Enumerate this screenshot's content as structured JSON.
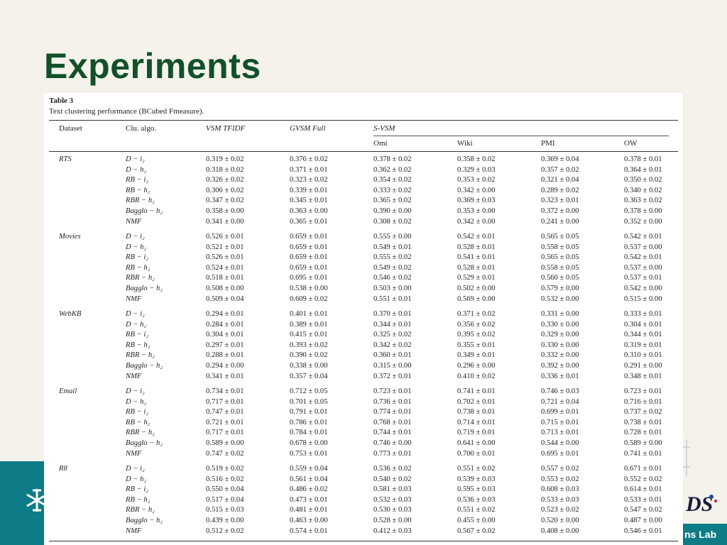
{
  "slide": {
    "title": "Experiments",
    "footer_lab_text": "ns Lab",
    "logo_text": "DS"
  },
  "table": {
    "number": "Table 3",
    "caption": "Text clustering performance (BCubed Fmeasure).",
    "headers": {
      "dataset": "Dataset",
      "algo": "Clu. algo.",
      "vsm": "VSM TFIDF",
      "gvsm": "GVSM Full",
      "svsm": "S-VSM",
      "omi": "Omi",
      "wiki": "Wiki",
      "pmi": "PMI",
      "ow": "OW"
    },
    "groups": [
      {
        "dataset": "RTS",
        "rows": [
          {
            "algo": "D − i₂",
            "vals": [
              "0.319 ± 0.02",
              "0.376 ± 0.02",
              "0.378 ± 0.02",
              "0.358 ± 0.02",
              "0.369 ± 0.04",
              "0.378 ± 0.01"
            ]
          },
          {
            "algo": "D − h₂",
            "vals": [
              "0.318 ± 0.02",
              "0.371 ± 0.01",
              "0.362 ± 0.02",
              "0.329 ± 0.03",
              "0.357 ± 0.02",
              "0.364 ± 0.01"
            ]
          },
          {
            "algo": "RB − i₂",
            "vals": [
              "0.326 ± 0.02",
              "0.323 ± 0.02",
              "0.354 ± 0.02",
              "0.353 ± 0.02",
              "0.321 ± 0.04",
              "0.350 ± 0.02"
            ]
          },
          {
            "algo": "RB − h₂",
            "vals": [
              "0.306 ± 0.02",
              "0.339 ± 0.01",
              "0.333 ± 0.02",
              "0.342 ± 0.00",
              "0.289 ± 0.02",
              "0.340 ± 0.02"
            ]
          },
          {
            "algo": "RBR − h₂",
            "vals": [
              "0.347 ± 0.02",
              "0.345 ± 0.01",
              "0.365 ± 0.02",
              "0.369 ± 0.03",
              "0.323 ± 0.01",
              "0.363 ± 0.02"
            ]
          },
          {
            "algo": "Bagglo − h₂",
            "vals": [
              "0.358 ± 0.00",
              "0.363 ± 0.00",
              "0.390 ± 0.00",
              "0.353 ± 0.00",
              "0.372 ± 0.00",
              "0.378 ± 0.00"
            ]
          },
          {
            "algo": "NMF",
            "vals": [
              "0.341 ± 0.00",
              "0.365 ± 0.01",
              "0.308 ± 0.02",
              "0.342 ± 0.00",
              "0.241 ± 0.00",
              "0.352 ± 0.00"
            ]
          }
        ]
      },
      {
        "dataset": "Movies",
        "rows": [
          {
            "algo": "D − i₂",
            "vals": [
              "0.526 ± 0.01",
              "0.659 ± 0.01",
              "0.555 ± 0.00",
              "0.542 ± 0.01",
              "0.565 ± 0.05",
              "0.542 ± 0.01"
            ]
          },
          {
            "algo": "D − h₂",
            "vals": [
              "0.521 ± 0.01",
              "0.659 ± 0.01",
              "0.549 ± 0.01",
              "0.528 ± 0.01",
              "0.558 ± 0.05",
              "0.537 ± 0.00"
            ]
          },
          {
            "algo": "RB − i₂",
            "vals": [
              "0.526 ± 0.01",
              "0.659 ± 0.01",
              "0.555 ± 0.02",
              "0.541 ± 0.01",
              "0.565 ± 0.05",
              "0.542 ± 0.01"
            ]
          },
          {
            "algo": "RB − h₂",
            "vals": [
              "0.524 ± 0.01",
              "0.659 ± 0.01",
              "0.549 ± 0.02",
              "0.528 ± 0.01",
              "0.558 ± 0.05",
              "0.537 ± 0.00"
            ]
          },
          {
            "algo": "RBR − h₂",
            "vals": [
              "0.518 ± 0.01",
              "0.695 ± 0.01",
              "0.546 ± 0.02",
              "0.529 ± 0.01",
              "0.560 ± 0.05",
              "0.537 ± 0.01"
            ]
          },
          {
            "algo": "Bagglo − h₂",
            "vals": [
              "0.508 ± 0.00",
              "0.538 ± 0.00",
              "0.503 ± 0.00",
              "0.502 ± 0.00",
              "0.579 ± 0.00",
              "0.542 ± 0.00"
            ]
          },
          {
            "algo": "NMF",
            "vals": [
              "0.509 ± 0.04",
              "0.609 ± 0.02",
              "0.551 ± 0.01",
              "0.569 ± 0.00",
              "0.532 ± 0.00",
              "0.515 ± 0.00"
            ]
          }
        ]
      },
      {
        "dataset": "WebKB",
        "rows": [
          {
            "algo": "D − i₂",
            "vals": [
              "0.294 ± 0.01",
              "0.401 ± 0.01",
              "0.370 ± 0.01",
              "0.371 ± 0.02",
              "0.331 ± 0.00",
              "0.333 ± 0.01"
            ]
          },
          {
            "algo": "D − h₂",
            "vals": [
              "0.284 ± 0.01",
              "0.389 ± 0.01",
              "0.344 ± 0.01",
              "0.356 ± 0.02",
              "0.330 ± 0.00",
              "0.304 ± 0.01"
            ]
          },
          {
            "algo": "RB − i₂",
            "vals": [
              "0.304 ± 0.01",
              "0.415 ± 0.01",
              "0.325 ± 0.02",
              "0.395 ± 0.02",
              "0.329 ± 0.00",
              "0.344 ± 0.01"
            ]
          },
          {
            "algo": "RB − h₂",
            "vals": [
              "0.297 ± 0.01",
              "0.393 ± 0.02",
              "0.342 ± 0.02",
              "0.355 ± 0.01",
              "0.330 ± 0.00",
              "0.319 ± 0.01"
            ]
          },
          {
            "algo": "RBR − h₂",
            "vals": [
              "0.288 ± 0.01",
              "0.390 ± 0.02",
              "0.360 ± 0.01",
              "0.349 ± 0.01",
              "0.332 ± 0.00",
              "0.310 ± 0.01"
            ]
          },
          {
            "algo": "Bagglo − h₂",
            "vals": [
              "0.294 ± 0.00",
              "0.338 ± 0.00",
              "0.315 ± 0.00",
              "0.296 ± 0.00",
              "0.392 ± 0.00",
              "0.291 ± 0.00"
            ]
          },
          {
            "algo": "NMF",
            "vals": [
              "0.341 ± 0.01",
              "0.357 ± 0.04",
              "0.372 ± 0.01",
              "0.410 ± 0.02",
              "0.336 ± 0.01",
              "0.348 ± 0.01"
            ]
          }
        ]
      },
      {
        "dataset": "Email",
        "rows": [
          {
            "algo": "D − i₂",
            "vals": [
              "0.734 ± 0.01",
              "0.712 ± 0.05",
              "0.723 ± 0.01",
              "0.741 ± 0.01",
              "0.746 ± 0.03",
              "0.723 ± 0.01"
            ]
          },
          {
            "algo": "D − h₂",
            "vals": [
              "0.717 ± 0.01",
              "0.701 ± 0.05",
              "0.736 ± 0.01",
              "0.702 ± 0.01",
              "0.721 ± 0.04",
              "0.716 ± 0.01"
            ]
          },
          {
            "algo": "RB − i₂",
            "vals": [
              "0.747 ± 0.01",
              "0.791 ± 0.01",
              "0.774 ± 0.01",
              "0.738 ± 0.01",
              "0.699 ± 0.01",
              "0.737 ± 0.02"
            ]
          },
          {
            "algo": "RB − h₂",
            "vals": [
              "0.721 ± 0.01",
              "0.786 ± 0.01",
              "0.768 ± 0.01",
              "0.714 ± 0.01",
              "0.715 ± 0.01",
              "0.738 ± 0.01"
            ]
          },
          {
            "algo": "RBR − h₂",
            "vals": [
              "0.717 ± 0.01",
              "0.784 ± 0.01",
              "0.744 ± 0.01",
              "0.719 ± 0.01",
              "0.713 ± 0.01",
              "0.728 ± 0.01"
            ]
          },
          {
            "algo": "Bagglo − h₂",
            "vals": [
              "0.589 ± 0.00",
              "0.678 ± 0.00",
              "0.746 ± 0.00",
              "0.641 ± 0.00",
              "0.544 ± 0.00",
              "0.589 ± 0.00"
            ]
          },
          {
            "algo": "NMF",
            "vals": [
              "0.747 ± 0.02",
              "0.753 ± 0.01",
              "0.773 ± 0.01",
              "0.700 ± 0.01",
              "0.695 ± 0.01",
              "0.741 ± 0.01"
            ]
          }
        ]
      },
      {
        "dataset": "R8",
        "rows": [
          {
            "algo": "D − i₂",
            "vals": [
              "0.519 ± 0.02",
              "0.559 ± 0.04",
              "0.536 ± 0.02",
              "0.551 ± 0.02",
              "0.557 ± 0.02",
              "0.671 ± 0.01"
            ]
          },
          {
            "algo": "D − h₂",
            "vals": [
              "0.516 ± 0.02",
              "0.561 ± 0.04",
              "0.540 ± 0.02",
              "0.539 ± 0.03",
              "0.553 ± 0.02",
              "0.552 ± 0.02"
            ]
          },
          {
            "algo": "RB − i₂",
            "vals": [
              "0.550 ± 0.04",
              "0.486 ± 0.02",
              "0.581 ± 0.03",
              "0.595 ± 0.03",
              "0.608 ± 0.03",
              "0.614 ± 0.01"
            ]
          },
          {
            "algo": "RB − h₂",
            "vals": [
              "0.517 ± 0.04",
              "0.473 ± 0.01",
              "0.532 ± 0.03",
              "0.536 ± 0.03",
              "0.533 ± 0.03",
              "0.533 ± 0.01"
            ]
          },
          {
            "algo": "RBR − h₂",
            "vals": [
              "0.515 ± 0.03",
              "0.481 ± 0.01",
              "0.530 ± 0.03",
              "0.551 ± 0.02",
              "0.523 ± 0.02",
              "0.547 ± 0.02"
            ]
          },
          {
            "algo": "Bagglo − h₂",
            "vals": [
              "0.439 ± 0.00",
              "0.463 ± 0.00",
              "0.528 ± 0.00",
              "0.455 ± 0.00",
              "0.520 ± 0.00",
              "0.487 ± 0.00"
            ]
          },
          {
            "algo": "NMF",
            "vals": [
              "0.512 ± 0.02",
              "0.574 ± 0.01",
              "0.412 ± 0.03",
              "0.567 ± 0.02",
              "0.408 ± 0.00",
              "0.546 ± 0.01"
            ]
          }
        ]
      }
    ]
  }
}
